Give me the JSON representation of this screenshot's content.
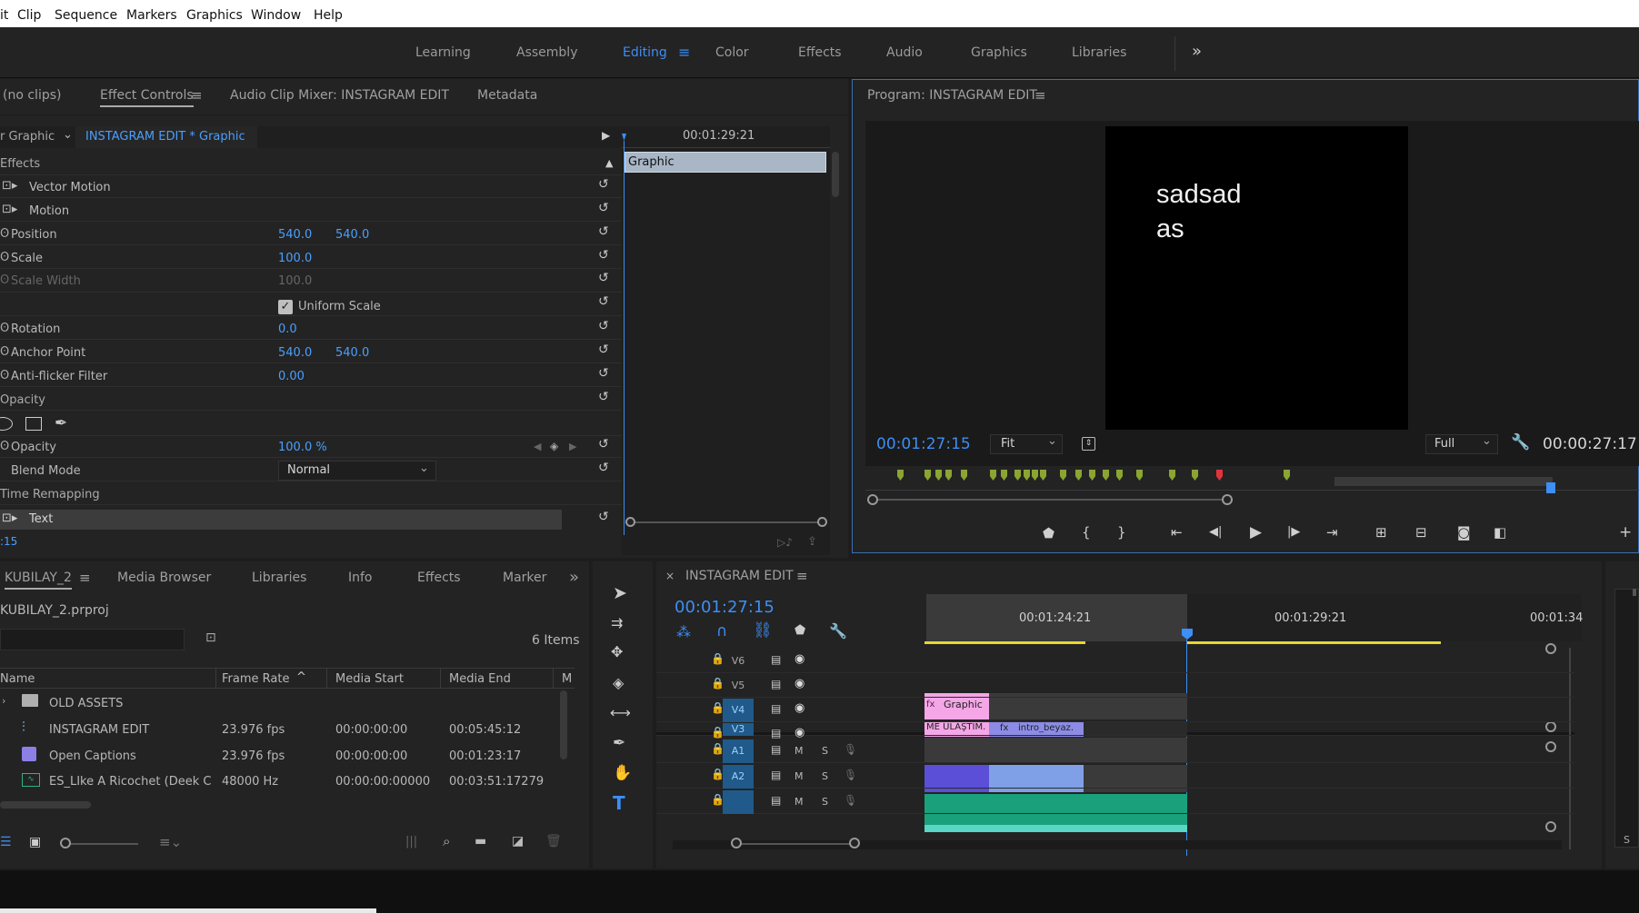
{
  "menu": [
    "it",
    "Clip",
    "Sequence",
    "Markers",
    "Graphics",
    "Window",
    "Help"
  ],
  "workspaces": {
    "items": [
      "Learning",
      "Assembly",
      "Editing",
      "Color",
      "Effects",
      "Audio",
      "Graphics",
      "Libraries"
    ],
    "active": "Editing",
    "overflow": "»"
  },
  "effect_panel": {
    "tabs": [
      "(no clips)",
      "Effect Controls",
      "Audio Clip Mixer: INSTAGRAM EDIT",
      "Metadata"
    ],
    "source_label": "r Graphic",
    "sequence_label": "INSTAGRAM EDIT * Graphic",
    "timecode_ruler": "00:01:29:21",
    "clip_bar_label": "Graphic",
    "section_effects": "Effects",
    "rows": {
      "vector_motion": "Vector Motion",
      "motion": "Motion",
      "position": "Position",
      "position_x": "540.0",
      "position_y": "540.0",
      "scale": "Scale",
      "scale_val": "100.0",
      "scale_width": "Scale Width",
      "scale_width_val": "100.0",
      "uniform_scale": "Uniform Scale",
      "rotation": "Rotation",
      "rotation_val": "0.0",
      "anchor_point": "Anchor Point",
      "anchor_x": "540.0",
      "anchor_y": "540.0",
      "antiflicker": "Anti-flicker Filter",
      "antiflicker_val": "0.00",
      "opacity_section": "Opacity",
      "opacity": "Opacity",
      "opacity_val": "100.0 %",
      "blend_mode": "Blend Mode",
      "blend_val": "Normal",
      "time_remap": "Time Remapping",
      "text": "Text"
    },
    "bottom_timecode": ":15"
  },
  "program": {
    "title": "Program: INSTAGRAM EDIT",
    "canvas_text_line1": "sadsad",
    "canvas_text_line2": "as",
    "current_time": "00:01:27:15",
    "fit": "Fit",
    "resolution": "Full",
    "duration": "00:00:27:17"
  },
  "project": {
    "tabs": [
      "KUBILAY_2",
      "Media Browser",
      "Libraries",
      "Info",
      "Effects",
      "Marker"
    ],
    "filename": "KUBILAY_2.prproj",
    "items_count": "6 Items",
    "columns": [
      "Name",
      "Frame Rate",
      "Media Start",
      "Media End",
      "M"
    ],
    "rows": [
      {
        "name": "OLD ASSETS",
        "rate": "",
        "start": "",
        "end": "",
        "type": "folder"
      },
      {
        "name": "INSTAGRAM EDIT",
        "rate": "23.976 fps",
        "start": "00:00:00:00",
        "end": "00:05:45:12",
        "type": "sequence"
      },
      {
        "name": "Open Captions",
        "rate": "23.976 fps",
        "start": "00:00:00:00",
        "end": "00:01:23:17",
        "type": "captions"
      },
      {
        "name": "ES_LIke A Ricochet (Deek C",
        "rate": "48000 Hz",
        "start": "00:00:00:00000",
        "end": "00:03:51:17279",
        "type": "audio"
      }
    ]
  },
  "timeline": {
    "title": "INSTAGRAM EDIT",
    "timecode": "00:01:27:15",
    "ruler": [
      "00:01:24:21",
      "00:01:29:21",
      "00:01:34"
    ],
    "tracks": [
      "V6",
      "V5",
      "V4",
      "V3",
      "A1",
      "A2"
    ],
    "clips": {
      "graphic": "Graphic",
      "me_ulastim": "ME ULAŞTIM.",
      "intro_beyaz": "intro_beyaz."
    },
    "audio_labels": {
      "m": "M",
      "s": "S"
    }
  },
  "colors": {
    "accent": "#3d8ef5",
    "graphic_clip": "#f4a6e6",
    "video_clip": "#8c8ce6",
    "audio_a1": "#5a4fd6",
    "audio_a2": "#1aa07a",
    "marker": "#8aa531",
    "marker_red": "#e0343c"
  }
}
